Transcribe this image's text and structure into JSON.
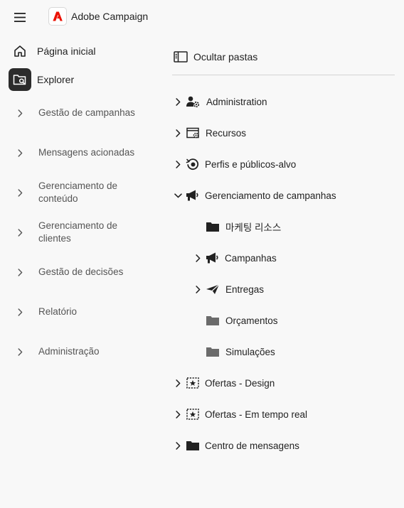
{
  "header": {
    "app_title": "Adobe Campaign",
    "brand_color": "#eb1000"
  },
  "sidebar": {
    "home_label": "Página inicial",
    "explorer_label": "Explorer",
    "items": [
      {
        "label": "Gestão de campanhas"
      },
      {
        "label": "Mensagens acionadas"
      },
      {
        "label": "Gerenciamento de conteúdo"
      },
      {
        "label": "Gerenciamento de clientes"
      },
      {
        "label": "Gestão de decisões"
      },
      {
        "label": "Relatório"
      },
      {
        "label": "Administração"
      }
    ]
  },
  "explorer": {
    "hide_folders_label": "Ocultar pastas",
    "tree": [
      {
        "label": "Administration",
        "icon": "admin-gear-icon",
        "expanded": false
      },
      {
        "label": "Recursos",
        "icon": "resources-icon",
        "expanded": false
      },
      {
        "label": "Perfis e públicos-alvo",
        "icon": "profiles-icon",
        "expanded": false
      },
      {
        "label": "Gerenciamento de campanhas",
        "icon": "megaphone-icon",
        "expanded": true,
        "children": [
          {
            "label": "마케팅 리소스",
            "icon": "folder-icon"
          },
          {
            "label": "Campanhas",
            "icon": "megaphone-icon",
            "expandable": true
          },
          {
            "label": "Entregas",
            "icon": "send-icon",
            "expandable": true
          },
          {
            "label": "Orçamentos",
            "icon": "folder-gray-icon"
          },
          {
            "label": "Simulações",
            "icon": "folder-gray-icon"
          }
        ]
      },
      {
        "label": "Ofertas - Design",
        "icon": "offer-star-icon",
        "expanded": false
      },
      {
        "label": "Ofertas - Em tempo real",
        "icon": "offer-star-icon",
        "expanded": false
      },
      {
        "label": "Centro de mensagens",
        "icon": "folder-icon",
        "expanded": false
      }
    ]
  }
}
